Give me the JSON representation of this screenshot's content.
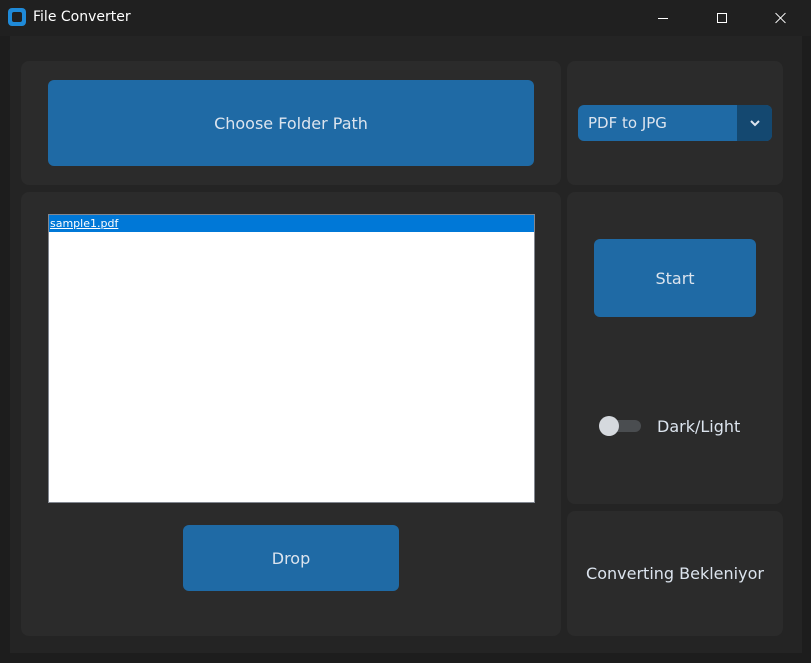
{
  "window": {
    "title": "File Converter",
    "controls": [
      "minimize",
      "maximize",
      "close"
    ]
  },
  "toolbar": {
    "choose_folder_label": "Choose Folder Path"
  },
  "conversion": {
    "selected": "PDF to JPG",
    "dropdown_icon": "chevron-down-icon"
  },
  "files": {
    "items": [
      "sample1.pdf"
    ],
    "selected_index": 0
  },
  "actions": {
    "start_label": "Start",
    "drop_label": "Drop"
  },
  "theme": {
    "toggle_label": "Dark/Light",
    "state": "off"
  },
  "status": {
    "text": "Converting Bekleniyor"
  },
  "colors": {
    "background": "#242424",
    "frame": "#2b2b2b",
    "accent": "#1f6aa5",
    "accent_dark": "#144870",
    "selection": "#0078d7"
  }
}
